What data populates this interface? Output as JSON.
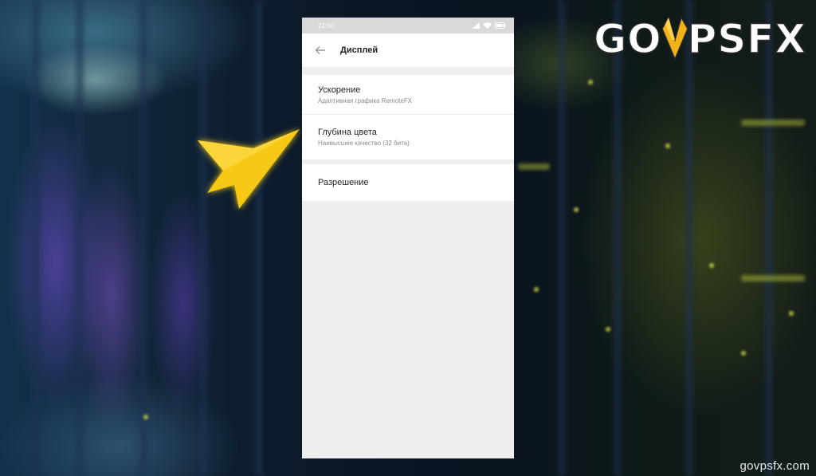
{
  "status_bar": {
    "time": "21:50"
  },
  "app_bar": {
    "title": "Дисплей"
  },
  "settings": [
    {
      "label": "Ускорение",
      "subtitle": "Адаптивная графика RemoteFX"
    },
    {
      "label": "Глубина цвета",
      "subtitle": "Наивысшее качество (32 бита)"
    },
    {
      "label": "Разрешение"
    }
  ],
  "branding": {
    "logo_left": "GO",
    "logo_right": "PSFX",
    "watermark": "govpsfx.com"
  },
  "colors": {
    "pointer": "#f6c915",
    "logo_v": "#f2b21a",
    "screen_bg": "#efefef"
  },
  "icons": [
    "back-arrow-icon",
    "signal-icon",
    "wifi-icon",
    "battery-icon",
    "pointer-arrow-icon"
  ]
}
